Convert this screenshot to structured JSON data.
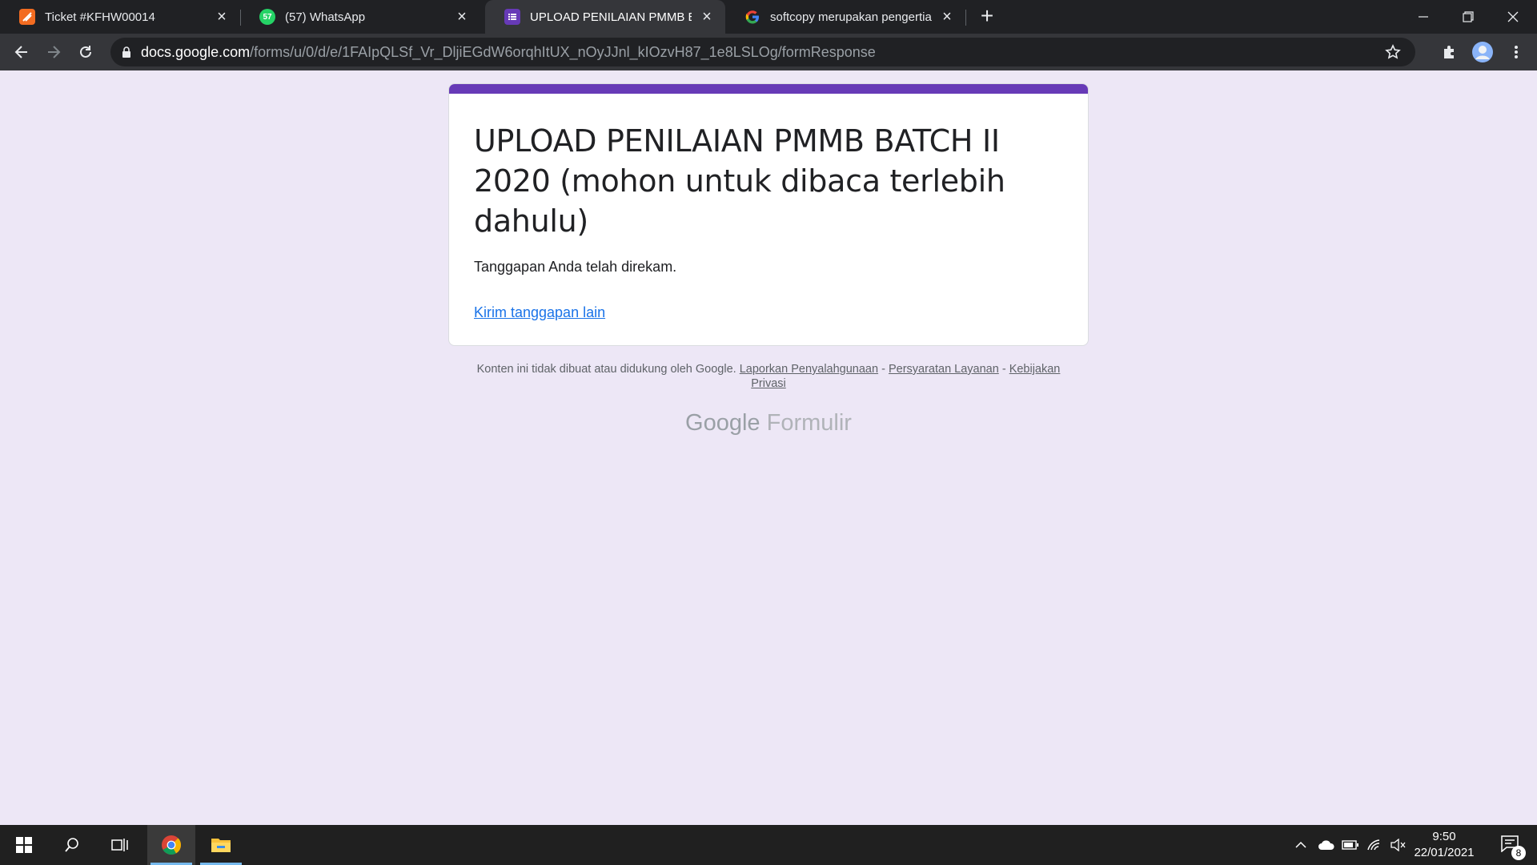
{
  "tabs": [
    {
      "label": "Ticket #KFHW00014",
      "icon": "ticket-favicon-icon",
      "active": false
    },
    {
      "label": "(57) WhatsApp",
      "icon": "whatsapp-icon",
      "badge": "57",
      "active": false
    },
    {
      "label": "UPLOAD PENILAIAN PMMB BATCH",
      "icon": "google-forms-icon",
      "active": true
    },
    {
      "label": "softcopy merupakan pengertian",
      "icon": "google-icon",
      "active": false
    }
  ],
  "address_bar": {
    "host": "docs.google.com",
    "path": "/forms/u/0/d/e/1FAIpQLSf_Vr_DljiEGdW6orqhItUX_nOyJJnl_kIOzvH87_1e8LSLOg/formResponse"
  },
  "form": {
    "title": "UPLOAD PENILAIAN PMMB BATCH II 2020 (mohon untuk dibaca terlebih dahulu)",
    "confirmation": "Tanggapan Anda telah direkam.",
    "another_response_link": "Kirim tanggapan lain",
    "accent_color": "#673ab7"
  },
  "footer": {
    "disclaimer": "Konten ini tidak dibuat atau didukung oleh Google.",
    "links": [
      "Laporkan Penyalahgunaan",
      "Persyaratan Layanan",
      "Kebijakan Privasi"
    ],
    "separator": " - ",
    "brand_google": "Google",
    "brand_product": "Formulir"
  },
  "taskbar": {
    "time": "9:50",
    "date": "22/01/2021",
    "notification_count": "8",
    "apps": [
      "start-icon",
      "search-icon",
      "task-view-icon",
      "chrome-icon",
      "file-explorer-icon"
    ]
  }
}
